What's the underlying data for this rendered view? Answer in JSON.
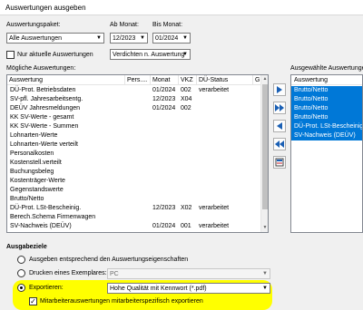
{
  "window": {
    "title": "Auswertungen ausgeben"
  },
  "filters": {
    "paket_label": "Auswertungspaket:",
    "paket_value": "Alle Auswertungen",
    "ab_label": "Ab Monat:",
    "ab_value": "12/2023",
    "bis_label": "Bis Monat:",
    "bis_value": "01/2024",
    "aktuelle_label": "Nur aktuelle Auswertungen",
    "aktuelle_checked": false,
    "verdichten_value": "Verdichten n. Auswertung"
  },
  "available": {
    "label": "Mögliche Auswertungen:",
    "columns": [
      "Auswertung",
      "Pers....",
      "Monat",
      "VKZ",
      "DÜ-Status",
      "G."
    ],
    "rows": [
      {
        "name": "DÜ-Prot. Betriebsdaten",
        "monat": "01/2024",
        "vkz": "002",
        "status": "verarbeitet"
      },
      {
        "name": "SV-pfl. Jahresarbeitsentg.",
        "monat": "12/2023",
        "vkz": "X04",
        "status": ""
      },
      {
        "name": "DEÜV Jahresmeldungen",
        "monat": "01/2024",
        "vkz": "002",
        "status": ""
      },
      {
        "name": "KK SV-Werte - gesamt",
        "monat": "",
        "vkz": "",
        "status": ""
      },
      {
        "name": "KK SV-Werte - Summen",
        "monat": "",
        "vkz": "",
        "status": ""
      },
      {
        "name": "Lohnarten-Werte",
        "monat": "",
        "vkz": "",
        "status": ""
      },
      {
        "name": "Lohnarten-Werte verteilt",
        "monat": "",
        "vkz": "",
        "status": ""
      },
      {
        "name": "Personalkosten",
        "monat": "",
        "vkz": "",
        "status": ""
      },
      {
        "name": "Kostenstell.verteilt",
        "monat": "",
        "vkz": "",
        "status": ""
      },
      {
        "name": "Buchungsbeleg",
        "monat": "",
        "vkz": "",
        "status": ""
      },
      {
        "name": "Kostenträger-Werte",
        "monat": "",
        "vkz": "",
        "status": ""
      },
      {
        "name": "Gegenstandswerte",
        "monat": "",
        "vkz": "",
        "status": ""
      },
      {
        "name": "Brutto/Netto",
        "monat": "",
        "vkz": "",
        "status": ""
      },
      {
        "name": "DÜ-Prot. LSt-Bescheinig.",
        "monat": "12/2023",
        "vkz": "X02",
        "status": "verarbeitet"
      },
      {
        "name": "Berech.Schema Firmenwagen",
        "monat": "",
        "vkz": "",
        "status": ""
      },
      {
        "name": "SV-Nachweis (DEÜV)",
        "monat": "01/2024",
        "vkz": "001",
        "status": "verarbeitet"
      }
    ]
  },
  "selected": {
    "label": "Ausgewählte Auswertungen",
    "column": "Auswertung",
    "rows": [
      "Brutto/Netto",
      "Brutto/Netto",
      "Brutto/Netto",
      "Brutto/Netto",
      "DÜ-Prot. LSt-Bescheinig.",
      "SV-Nachweis (DEÜV)"
    ]
  },
  "ausgabeziele": {
    "title": "Ausgabeziele",
    "option1": "Ausgeben entsprechend den Auswertungseigenschaften",
    "option2": "Drucken eines Exemplares:",
    "printer_value": "PC",
    "option3": "Exportieren:",
    "export_value": "Hohe Qualität mit Kennwort (*.pdf)",
    "mitarbeiter_label": "Mitarbeiterauswertungen mitarbeiterspezifisch exportieren",
    "mitarbeiter_checked": true,
    "highlight_color": "#ffff00"
  },
  "colors": {
    "selection": "#0078d7"
  }
}
